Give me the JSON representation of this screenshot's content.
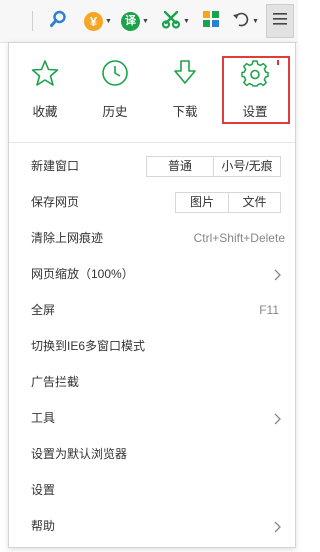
{
  "toolbar": {
    "icons": [
      "search-icon",
      "yen-coin-icon",
      "translate-icon",
      "scissors-icon",
      "apps-grid-icon",
      "undo-icon",
      "menu-icon"
    ],
    "translate_glyph": "译",
    "yen_glyph": "¥",
    "colors": {
      "accent": "#1aa34a",
      "yen": "#f5a623",
      "search": "#2a7fd6"
    }
  },
  "quick_actions": [
    {
      "label": "收藏",
      "icon": "star-icon"
    },
    {
      "label": "历史",
      "icon": "clock-icon"
    },
    {
      "label": "下载",
      "icon": "download-icon"
    },
    {
      "label": "设置",
      "icon": "gear-icon"
    }
  ],
  "highlight_color": "#e23b3b",
  "menu": {
    "new_window": {
      "label": "新建窗口",
      "options": [
        "普通",
        "小号/无痕"
      ]
    },
    "save_page": {
      "label": "保存网页",
      "options": [
        "图片",
        "文件"
      ]
    },
    "clear_traces": {
      "label": "清除上网痕迹",
      "shortcut": "Ctrl+Shift+Delete"
    },
    "zoom": {
      "label": "网页缩放（100%）"
    },
    "fullscreen": {
      "label": "全屏",
      "shortcut": "F11"
    },
    "ie6_mode": {
      "label": "切换到IE6多窗口模式"
    },
    "ad_block": {
      "label": "广告拦截"
    },
    "tools": {
      "label": "工具"
    },
    "default_browser": {
      "label": "设置为默认浏览器"
    },
    "settings": {
      "label": "设置"
    },
    "help": {
      "label": "帮助"
    }
  }
}
